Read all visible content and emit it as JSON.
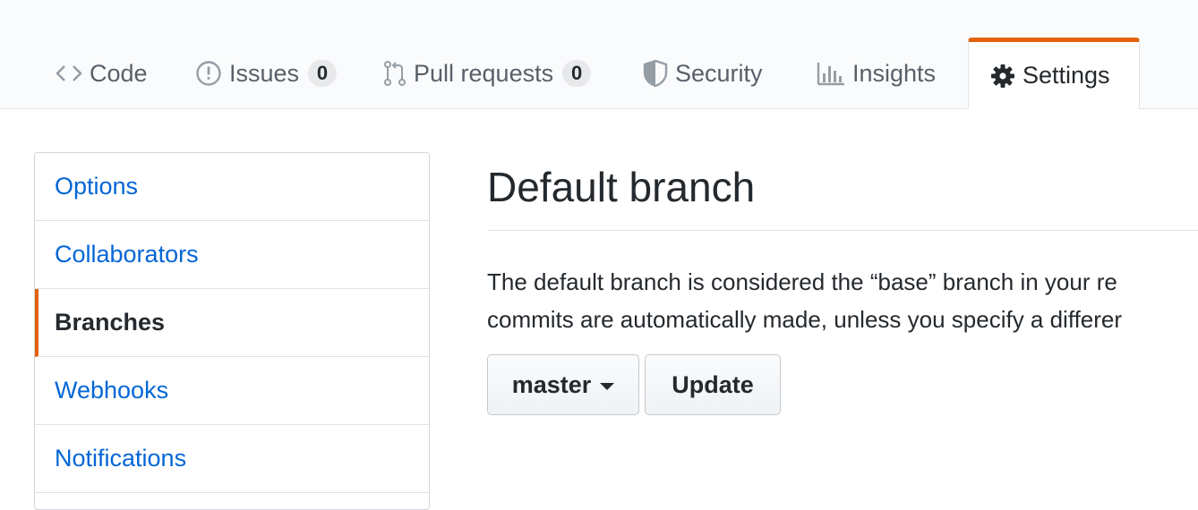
{
  "repo_nav": {
    "tabs": [
      {
        "label": "Code",
        "icon": "code-icon"
      },
      {
        "label": "Issues",
        "icon": "issue-opened-icon",
        "count": "0"
      },
      {
        "label": "Pull requests",
        "icon": "git-pull-request-icon",
        "count": "0"
      },
      {
        "label": "Security",
        "icon": "shield-icon"
      },
      {
        "label": "Insights",
        "icon": "graph-icon"
      },
      {
        "label": "Settings",
        "icon": "gear-icon",
        "selected": true
      }
    ],
    "accent_color": "#e36209"
  },
  "settings_menu": {
    "items": [
      {
        "label": "Options"
      },
      {
        "label": "Collaborators"
      },
      {
        "label": "Branches",
        "selected": true
      },
      {
        "label": "Webhooks"
      },
      {
        "label": "Notifications"
      }
    ],
    "link_color": "#0366d6"
  },
  "main": {
    "title": "Default branch",
    "description_line1": "The default branch is considered the “base” branch in your re",
    "description_line2": "commits are automatically made, unless you specify a differer",
    "branch_select_label": "master",
    "update_button_label": "Update"
  }
}
